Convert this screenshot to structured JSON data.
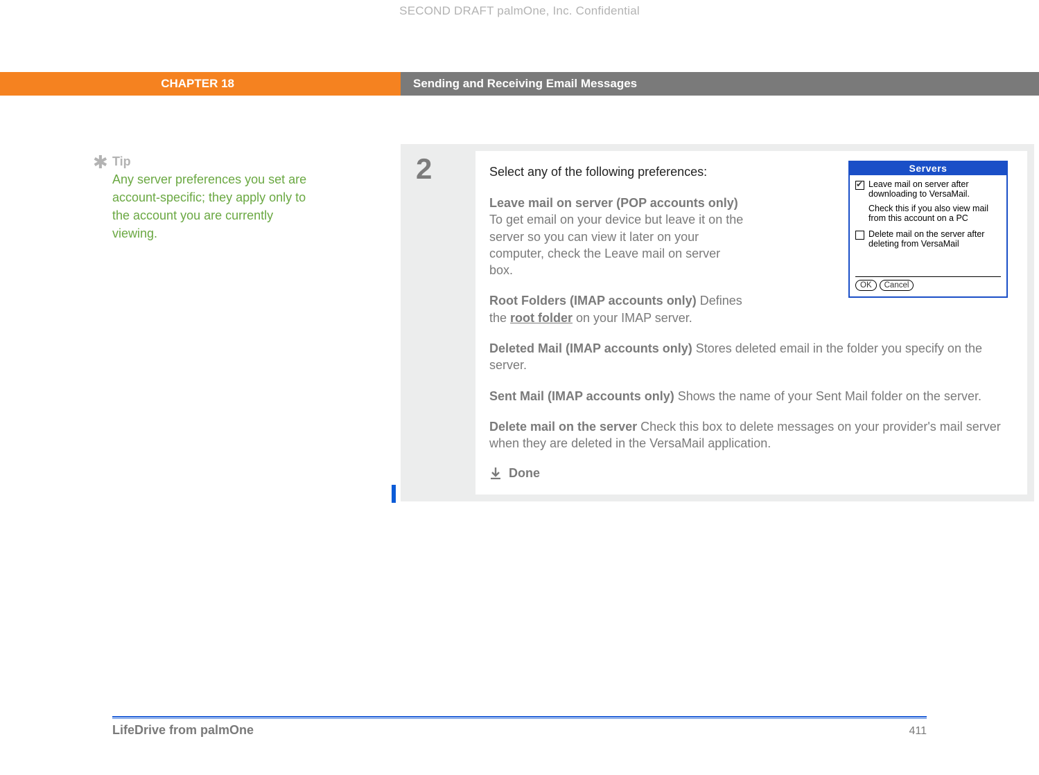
{
  "header": {
    "confidential": "SECOND DRAFT palmOne, Inc.  Confidential",
    "chapter_label": "CHAPTER 18",
    "chapter_title": "Sending and Receiving Email Messages"
  },
  "tip": {
    "label": "Tip",
    "text": "Any server preferences you set are account-specific; they apply only to the account you are currently viewing."
  },
  "step": {
    "number": "2",
    "intro": "Select any of the following preferences:",
    "para1_bold": "Leave mail on server (POP accounts only)",
    "para1_text": "   To get email on your device but leave it on the server so you can view it later on your computer, check the Leave mail on server box.",
    "para2_bold": "Root Folders (IMAP accounts only)",
    "para2_pre": "    Defines the ",
    "para2_link": "root folder",
    "para2_post": " on your IMAP server.",
    "para3_bold": "Deleted Mail (IMAP accounts only)",
    "para3_text": "    Stores deleted email in the folder you specify on the server.",
    "para4_bold": "Sent Mail (IMAP accounts only)",
    "para4_text": "    Shows the name of your Sent Mail folder on the server.",
    "para5_bold": "Delete mail on the server",
    "para5_text": "   Check this box to delete messages on your provider's mail server when they are deleted in the VersaMail application.",
    "done_label": "Done"
  },
  "dialog": {
    "title": "Servers",
    "opt1": "Leave mail on server after downloading to VersaMail.",
    "opt1_sub": "Check this if you also view mail from this account on a PC",
    "opt2": "Delete mail on the server after deleting from VersaMail",
    "ok": "OK",
    "cancel": "Cancel"
  },
  "footer": {
    "product": "LifeDrive from palmOne",
    "page": "411"
  }
}
